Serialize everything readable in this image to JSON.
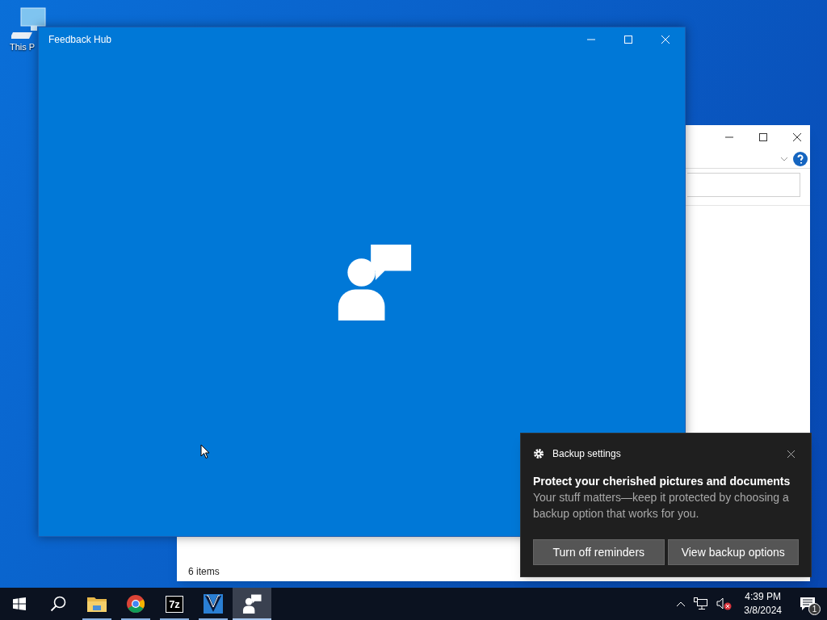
{
  "desktop_icons": [
    {
      "label": "This P"
    }
  ],
  "explorer_window": {
    "status": "6 items"
  },
  "feedback_window": {
    "title": "Feedback Hub"
  },
  "notification": {
    "app": "Backup settings",
    "title": "Protect your cherished pictures and documents",
    "body": "Your stuff matters—keep it protected by choosing a backup option that works for you.",
    "buttons": [
      "Turn off reminders",
      "View backup options"
    ]
  },
  "taskbar": {
    "apps": [
      {
        "kind": "folder",
        "running": true,
        "selected": false
      },
      {
        "kind": "chrome",
        "running": true,
        "selected": false
      },
      {
        "kind": "archiver",
        "label": "7z",
        "running": true,
        "selected": false
      },
      {
        "kind": "video",
        "running": true,
        "selected": false
      },
      {
        "kind": "feedback",
        "running": true,
        "selected": true
      }
    ],
    "time": "4:39 PM",
    "date": "3/8/2024",
    "notification_count": "1"
  }
}
